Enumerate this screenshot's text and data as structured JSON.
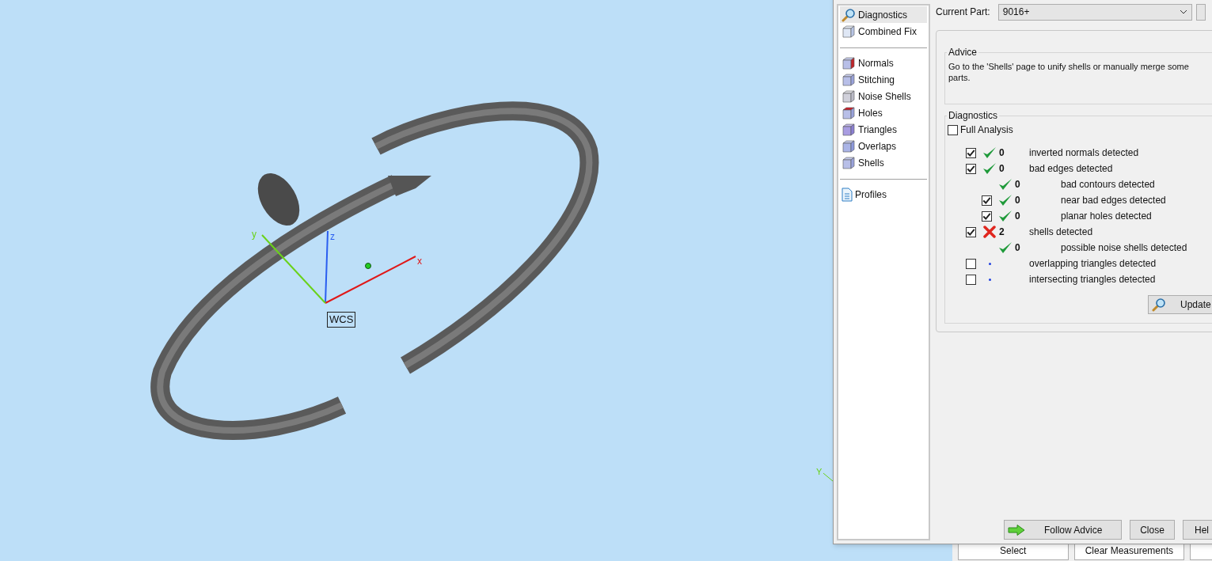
{
  "viewport": {
    "axes": {
      "x": "x",
      "y": "y",
      "z": "z"
    },
    "wcs_label": "WCS",
    "corner_axis_label": "Y"
  },
  "bottom_toolbar": {
    "buttons": [
      "Select",
      "Clear Measurements"
    ]
  },
  "dialog": {
    "nav": {
      "groups": [
        [
          {
            "label": "Diagnostics",
            "selected": true
          },
          {
            "label": "Combined Fix",
            "selected": false
          }
        ],
        [
          {
            "label": "Normals",
            "selected": false
          },
          {
            "label": "Stitching",
            "selected": false
          },
          {
            "label": "Noise Shells",
            "selected": false
          },
          {
            "label": "Holes",
            "selected": false
          },
          {
            "label": "Triangles",
            "selected": false
          },
          {
            "label": "Overlaps",
            "selected": false
          },
          {
            "label": "Shells",
            "selected": false
          }
        ],
        [
          {
            "label": "Profiles",
            "selected": false
          }
        ]
      ]
    },
    "current_part": {
      "label": "Current Part:",
      "value": "9016+"
    },
    "advice": {
      "title": "Advice",
      "text": "Go to the 'Shells' page to unify shells or manually merge some parts."
    },
    "diagnostics": {
      "title": "Diagnostics",
      "full_analysis": {
        "label": "Full Analysis",
        "checked": false
      },
      "rows": [
        {
          "checked": true,
          "kind": "ok",
          "count": "0",
          "label": "inverted normals detected"
        },
        {
          "checked": true,
          "kind": "ok",
          "count": "0",
          "label": "bad edges detected",
          "children": [
            {
              "kind": "ok",
              "count": "0",
              "label": "bad contours detected"
            },
            {
              "checked": true,
              "kind": "ok",
              "count": "0",
              "label": "near bad edges detected"
            },
            {
              "checked": true,
              "kind": "ok",
              "count": "0",
              "label": "planar holes detected"
            }
          ]
        },
        {
          "checked": true,
          "kind": "fail",
          "count": "2",
          "label": "shells detected",
          "children": [
            {
              "kind": "ok",
              "count": "0",
              "label": "possible noise shells detected"
            }
          ]
        },
        {
          "checked": false,
          "kind": "pending",
          "label": "overlapping triangles detected"
        },
        {
          "checked": false,
          "kind": "pending",
          "label": "intersecting triangles detected"
        }
      ],
      "update_button": "Update"
    },
    "buttons": {
      "follow_advice": "Follow Advice",
      "close": "Close",
      "help": "Hel"
    }
  }
}
